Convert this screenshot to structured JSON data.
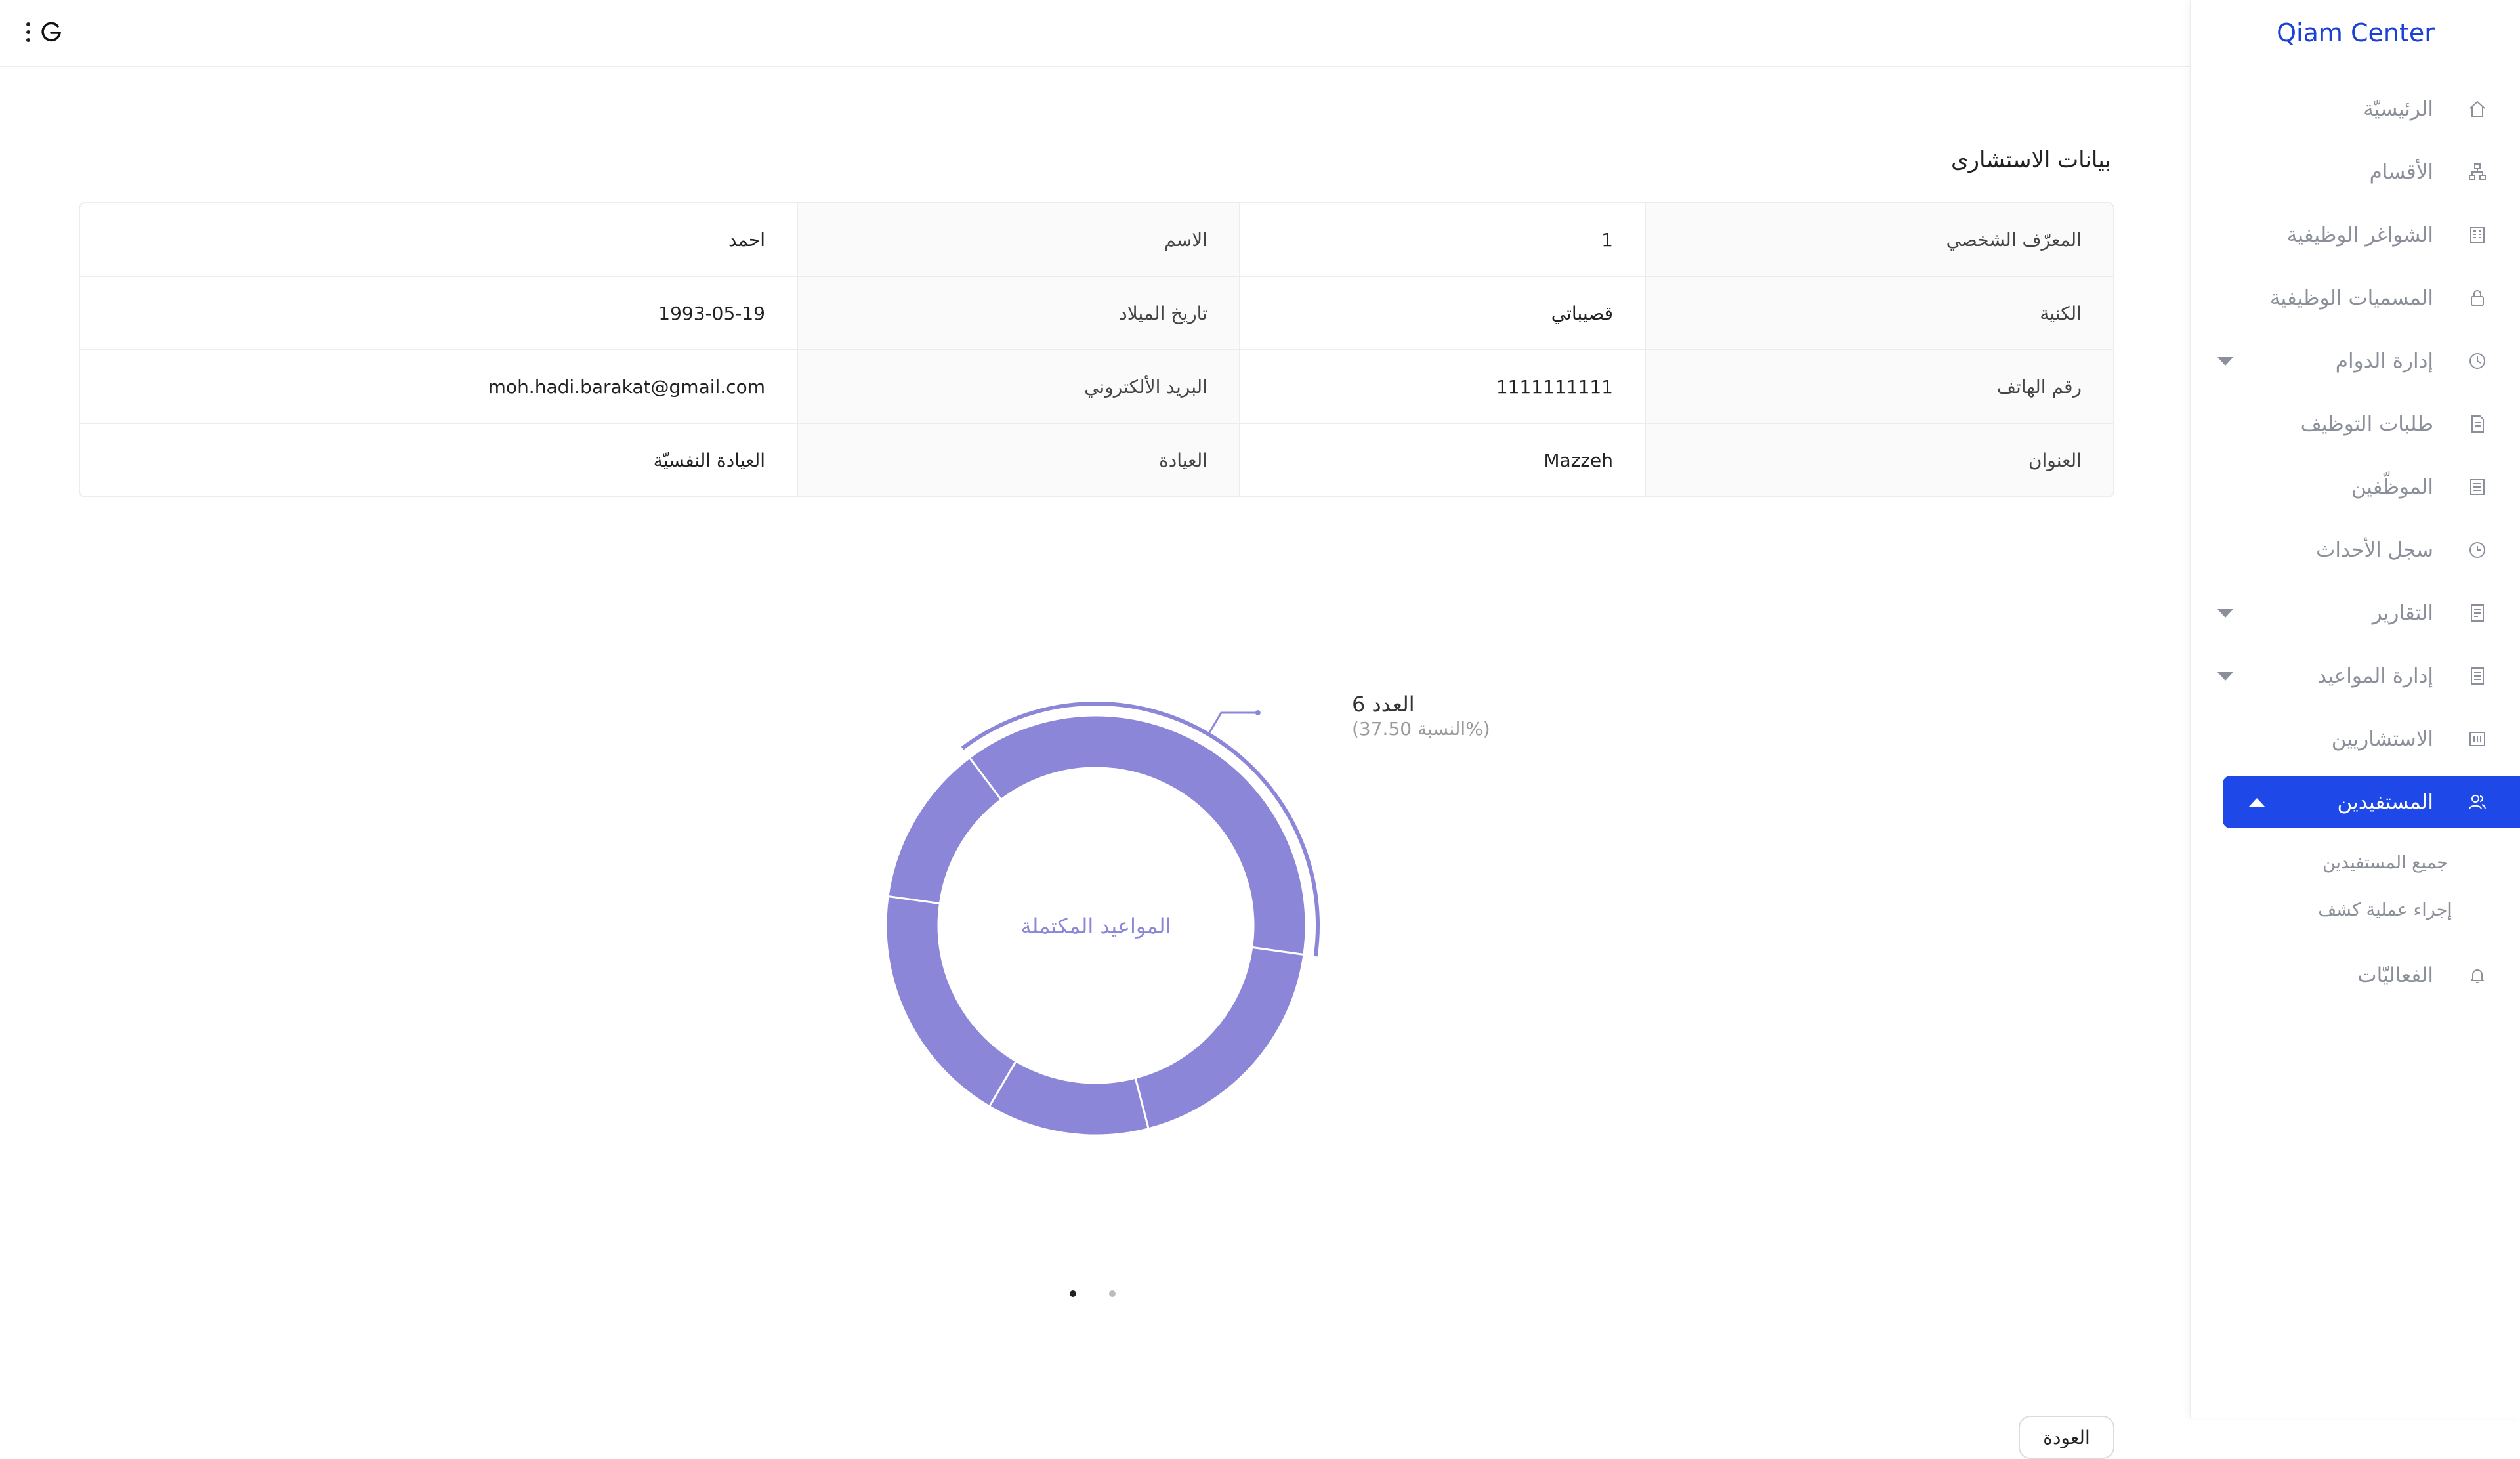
{
  "brand": "Qiam Center",
  "sidebar": {
    "items": [
      {
        "label": "الرئيسيّة",
        "icon": "home-icon"
      },
      {
        "label": "الأقسام",
        "icon": "sitemap-icon"
      },
      {
        "label": "الشواغر الوظيفية",
        "icon": "building-icon"
      },
      {
        "label": "المسميات الوظيفية",
        "icon": "lock-icon"
      },
      {
        "label": "إدارة الدوام",
        "icon": "clock-icon"
      },
      {
        "label": "طلبات التوظيف",
        "icon": "document-icon"
      },
      {
        "label": "الموظّفين",
        "icon": "list-icon"
      },
      {
        "label": "سجل الأحداث",
        "icon": "history-icon"
      },
      {
        "label": "التقارير",
        "icon": "report-icon"
      },
      {
        "label": "إدارة المواعيد",
        "icon": "calendar-list-icon"
      },
      {
        "label": "الاستشاريين",
        "icon": "advisor-icon"
      },
      {
        "label": "المستفيدين",
        "icon": "users-icon"
      },
      {
        "label": "الفعاليّات",
        "icon": "bell-icon"
      }
    ],
    "submenu": [
      "جميع المستفيدين",
      "إجراء عملية كشف"
    ]
  },
  "page": {
    "title": "بيانات الاستشارى",
    "rows": [
      {
        "label1": "المعرّف الشخصي",
        "value1": "1",
        "label2": "الاسم",
        "value2": "احمد"
      },
      {
        "label1": "الكنية",
        "value1": "قصيباتي",
        "label2": "تاريخ الميلاد",
        "value2": "1993-05-19"
      },
      {
        "label1": "رقم الهاتف",
        "value1": "1111111111",
        "label2": "البريد الألكتروني",
        "value2": "moh.hadi.barakat@gmail.com"
      },
      {
        "label1": "العنوان",
        "value1": "Mazzeh",
        "label2": "العيادة",
        "value2": "العيادة النفسيّة"
      }
    ],
    "back_label": "العودة"
  },
  "chart_data": {
    "type": "pie",
    "center_label": "المواعيد المكتملة",
    "color": "#8b86d8",
    "slices": [
      {
        "value": 6,
        "percent": 37.5
      },
      {
        "value": 3,
        "percent": 18.75
      },
      {
        "value": 2,
        "percent": 12.5
      },
      {
        "value": 3,
        "percent": 18.75
      },
      {
        "value": 2,
        "percent": 12.5
      }
    ],
    "tooltip": {
      "line1": "العدد 6",
      "line2": "(37.50 النسبة%)"
    }
  },
  "pagination": {
    "pages": 2,
    "current": 1
  }
}
